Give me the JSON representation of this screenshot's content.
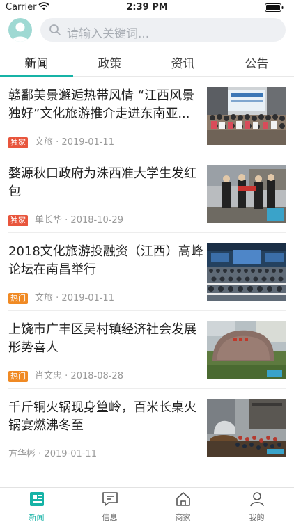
{
  "status_bar": {
    "carrier": "Carrier",
    "time": "2:39 PM"
  },
  "search": {
    "placeholder": "请输入关键词..."
  },
  "tabs": [
    {
      "label": "新闻"
    },
    {
      "label": "政策"
    },
    {
      "label": "资讯"
    },
    {
      "label": "公告"
    }
  ],
  "news": [
    {
      "title": "赣鄱美景邂逅热带风情 “江西风景独好”文化旅游推介走进东南亚...",
      "badge": "独家",
      "source": "文旅",
      "date": "2019-01-11"
    },
    {
      "title": "婺源秋口政府为洙西准大学生发红包",
      "badge": "独家",
      "source": "单长华",
      "date": "2018-10-29"
    },
    {
      "title": "2018文化旅游投融资（江西）高峰论坛在南昌举行",
      "badge": "热门",
      "source": "文旅",
      "date": "2019-01-11"
    },
    {
      "title": "上饶市广丰区吴村镇经济社会发展形势喜人",
      "badge": "热门",
      "source": "肖文忠",
      "date": "2018-08-28"
    },
    {
      "title": "千斤铜火锅现身篁岭，百米长桌火锅宴燃沸冬至",
      "source": "方华彬",
      "date": "2019-01-11"
    }
  ],
  "tabbar": [
    {
      "label": "新闻"
    },
    {
      "label": "信息"
    },
    {
      "label": "商家"
    },
    {
      "label": "我的"
    }
  ],
  "colors": {
    "accent": "#16b3a6",
    "badge_exclusive": "#e8553c",
    "badge_hot": "#f08a24"
  }
}
